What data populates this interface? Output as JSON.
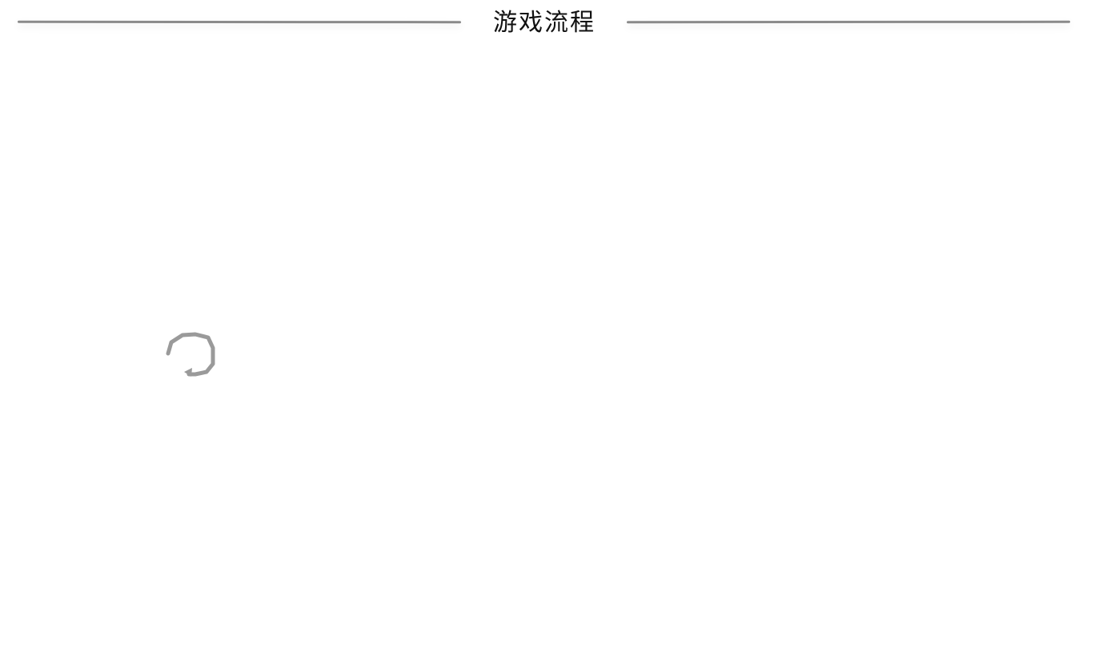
{
  "header": {
    "title": "游戏流程"
  },
  "icons": {
    "loop": "rotate-loop-icon"
  },
  "colors": {
    "rule": "#8a8a8a",
    "title": "#111111",
    "icon": "#9a9a9a",
    "background": "#ffffff"
  }
}
